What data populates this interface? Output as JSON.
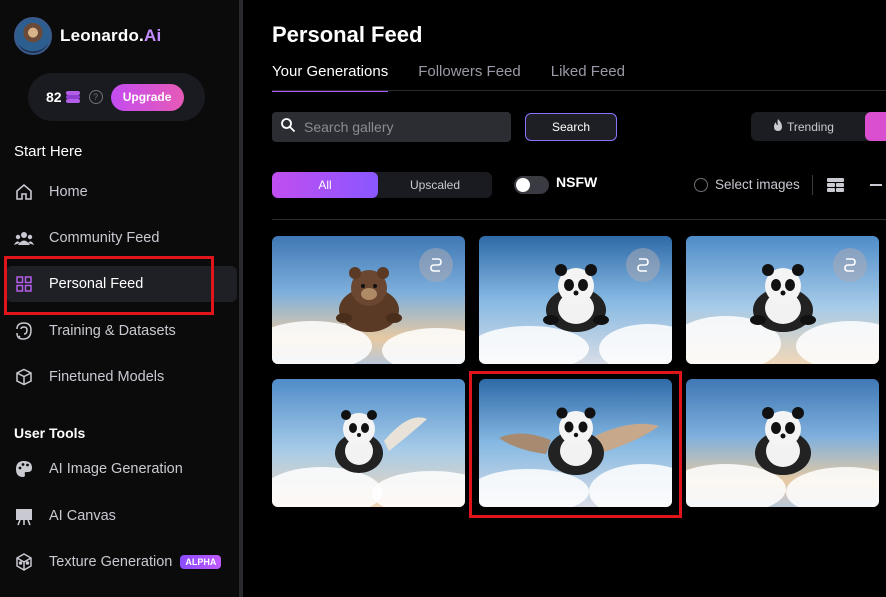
{
  "app": {
    "brand_name": "Leonardo.",
    "brand_suffix": "Ai",
    "credits": "82",
    "upgrade_label": "Upgrade"
  },
  "sidebar": {
    "section_start": "Start Here",
    "start_items": [
      {
        "label": "Home",
        "icon": "home-icon"
      },
      {
        "label": "Community Feed",
        "icon": "community-icon"
      },
      {
        "label": "Personal Feed",
        "icon": "grid-icon",
        "active": true
      },
      {
        "label": "Training & Datasets",
        "icon": "training-icon"
      },
      {
        "label": "Finetuned Models",
        "icon": "cube-icon"
      }
    ],
    "section_tools": "User Tools",
    "tool_items": [
      {
        "label": "AI Image Generation",
        "icon": "palette-icon"
      },
      {
        "label": "AI Canvas",
        "icon": "easel-icon"
      },
      {
        "label": "Texture Generation",
        "icon": "texture-icon",
        "badge": "ALPHA"
      }
    ]
  },
  "main": {
    "title": "Personal Feed",
    "tabs": [
      {
        "label": "Your Generations",
        "active": true
      },
      {
        "label": "Followers Feed"
      },
      {
        "label": "Liked Feed"
      }
    ],
    "search": {
      "placeholder": "Search gallery",
      "button_label": "Search"
    },
    "trending_label": "Trending",
    "filter": {
      "all_label": "All",
      "upscaled_label": "Upscaled"
    },
    "nsfw_label": "NSFW",
    "select_label": "Select images",
    "gallery": [
      {
        "subject": "bear flying in clouds",
        "remix": true
      },
      {
        "subject": "panda flying in clouds",
        "remix": true
      },
      {
        "subject": "panda flying in clouds",
        "remix": true
      },
      {
        "subject": "panda with wings in sky",
        "remix": false
      },
      {
        "subject": "panda with wings in sky",
        "remix": false,
        "highlighted": true
      },
      {
        "subject": "panda in sky",
        "remix": false
      }
    ]
  },
  "colors": {
    "accent_purple": "#a45cff",
    "accent_pink": "#e65ab6",
    "highlight_red": "#e0141b"
  }
}
